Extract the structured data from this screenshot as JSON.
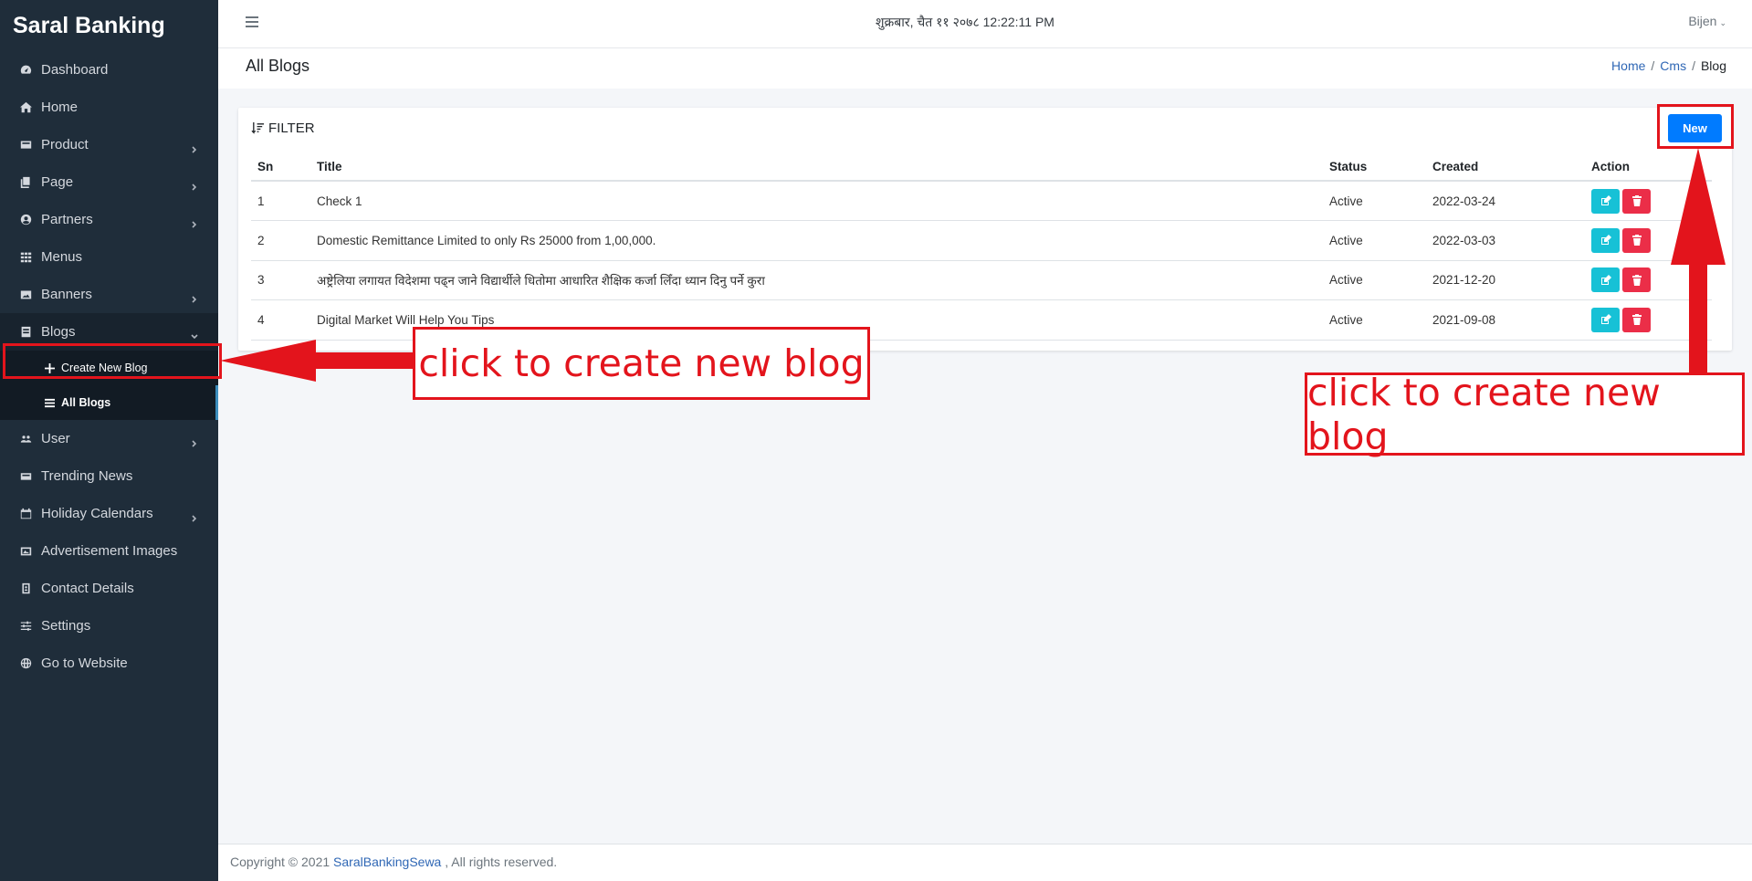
{
  "brand": "Saral Banking",
  "sidebar": {
    "items": [
      {
        "label": "Dashboard",
        "icon": "dashboard-icon"
      },
      {
        "label": "Home",
        "icon": "home-icon"
      },
      {
        "label": "Product",
        "icon": "product-icon"
      },
      {
        "label": "Page",
        "icon": "page-icon"
      },
      {
        "label": "Partners",
        "icon": "partners-icon"
      },
      {
        "label": "Menus",
        "icon": "grid-icon"
      },
      {
        "label": "Banners",
        "icon": "image-icon"
      },
      {
        "label": "Blogs",
        "icon": "blogs-icon"
      },
      {
        "label": "User",
        "icon": "users-icon"
      },
      {
        "label": "Trending News",
        "icon": "news-icon"
      },
      {
        "label": "Holiday Calendars",
        "icon": "calendar-icon"
      },
      {
        "label": "Advertisement Images",
        "icon": "ad-image-icon"
      },
      {
        "label": "Contact Details",
        "icon": "contact-icon"
      },
      {
        "label": "Settings",
        "icon": "settings-sliders-icon"
      },
      {
        "label": "Go to Website",
        "icon": "globe-icon"
      }
    ],
    "blogs_sub": {
      "create": "Create New Blog",
      "all": "All Blogs"
    }
  },
  "topbar": {
    "datetime": "शुक्रबार, चैत ११ २०७८ 12:22:11 PM",
    "user": "Bijen"
  },
  "header": {
    "title": "All Blogs",
    "breadcrumb": [
      "Home",
      "Cms",
      "Blog"
    ]
  },
  "card": {
    "filter_label": "FILTER",
    "new_label": "New",
    "columns": [
      "Sn",
      "Title",
      "Status",
      "Created",
      "Action"
    ],
    "rows": [
      {
        "sn": "1",
        "title": "Check 1",
        "status": "Active",
        "created": "2022-03-24"
      },
      {
        "sn": "2",
        "title": "Domestic Remittance Limited to only Rs 25000 from 1,00,000.",
        "status": "Active",
        "created": "2022-03-03"
      },
      {
        "sn": "3",
        "title": "अष्ट्रेलिया लगायत विदेशमा पढ्न जाने विद्यार्थीले धितोमा आधारित शैक्षिक कर्जा लिँदा ध्यान दिनु पर्ने कुरा",
        "status": "Active",
        "created": "2021-12-20"
      },
      {
        "sn": "4",
        "title": "Digital Market Will Help You Tips",
        "status": "Active",
        "created": "2021-09-08"
      }
    ]
  },
  "footer": {
    "prefix": "Copyright © 2021 ",
    "link": "SaralBankingSewa",
    "suffix": " , All rights reserved."
  },
  "annotations": {
    "left": "click to create new blog",
    "right": "click to create new blog",
    "color": "#e3141c"
  }
}
